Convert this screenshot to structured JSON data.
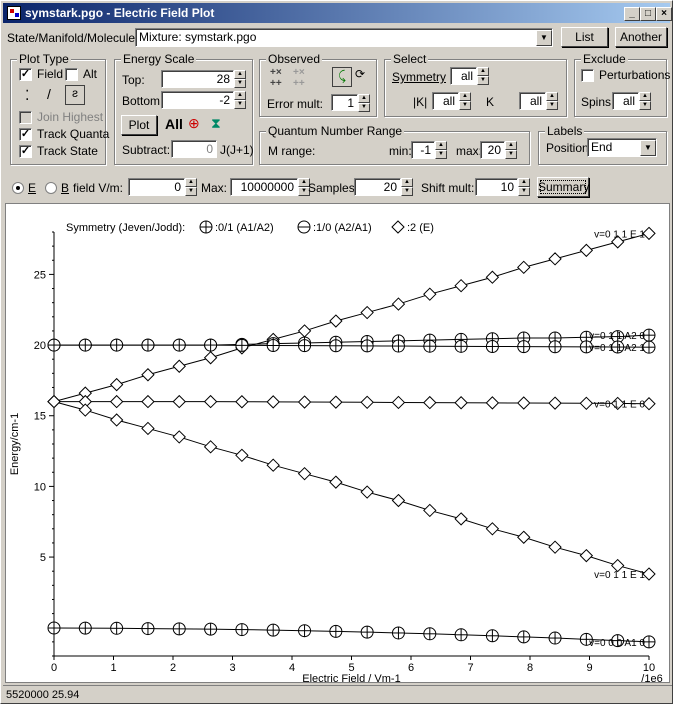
{
  "window": {
    "title": "symstark.pgo - Electric Field Plot"
  },
  "top": {
    "label": "State/Manifold/Molecule:",
    "selected": "Mixture: symstark.pgo",
    "list_button": "List",
    "another_button": "Another"
  },
  "plot_type": {
    "title": "Plot Type",
    "field": "Field",
    "alt": "Alt",
    "join_highest": "Join Highest",
    "track_quanta": "Track Quanta",
    "track_state": "Track State",
    "field_checked": true,
    "alt_checked": false,
    "track_quanta_checked": true,
    "track_state_checked": true
  },
  "energy_scale": {
    "title": "Energy Scale",
    "top_label": "Top:",
    "top_value": "28",
    "bottom_label": "Bottom:",
    "bottom_value": "-2",
    "plot_button": "Plot",
    "all_label": "All",
    "subtract_label": "Subtract:",
    "subtract_value": "0",
    "subtract_unit": "J(J+1)"
  },
  "observed": {
    "title": "Observed",
    "error_mult_label": "Error mult:",
    "error_mult_value": "1"
  },
  "select": {
    "title": "Select",
    "symmetry_label": "Symmetry",
    "symmetry_value": "all",
    "k_abs_label": "|K|",
    "k_abs_value": "all",
    "k_label": "K",
    "k_value": "all"
  },
  "exclude": {
    "title": "Exclude",
    "perturbations": "Perturbations",
    "spins_label": "Spins:",
    "spins_value": "all"
  },
  "qnr": {
    "title": "Quantum Number Range",
    "m_range": "M range:",
    "min_label": "min:",
    "min_value": "-1",
    "max_label": "max:",
    "max_value": "20"
  },
  "labels": {
    "title": "Labels",
    "position_label": "Position",
    "position_value": "End"
  },
  "fieldbar": {
    "e_label": "E",
    "b_label": "B",
    "field_label": "field V/m:",
    "field_value": "0",
    "max_label": "Max:",
    "max_value": "10000000",
    "samples_label": "Samples",
    "samples_value": "20",
    "shift_label": "Shift mult:",
    "shift_value": "10",
    "summary_button": "Summary"
  },
  "status": {
    "text": "5520000  25.94"
  },
  "chart_data": {
    "type": "line",
    "xlabel": "Electric Field / Vm-1",
    "ylabel": "Energy/cm-1",
    "x_multiplier_label": "/1e6",
    "xlim": [
      0,
      10
    ],
    "ylim": [
      -2,
      28
    ],
    "x_ticks": [
      0,
      1,
      2,
      3,
      4,
      5,
      6,
      7,
      8,
      9,
      10
    ],
    "y_ticks": [
      5,
      10,
      15,
      20,
      25
    ],
    "legend": {
      "title": "Symmetry (Jeven/Jodd):",
      "entries": [
        {
          "marker": "circle-plus",
          "label": ":0/1 (A1/A2)"
        },
        {
          "marker": "circle-minus",
          "label": ":1/0 (A2/A1)"
        },
        {
          "marker": "diamond",
          "label": ":2 (E)"
        }
      ]
    },
    "x": [
      0,
      0.526,
      1.053,
      1.579,
      2.105,
      2.632,
      3.158,
      3.684,
      4.211,
      4.737,
      5.263,
      5.789,
      6.316,
      6.842,
      7.368,
      7.895,
      8.421,
      8.947,
      9.474,
      10
    ],
    "series": [
      {
        "marker": "diamond",
        "label": "v=0  1  1 E  1",
        "values": [
          16,
          16.6,
          17.2,
          17.9,
          18.5,
          19.1,
          19.8,
          20.4,
          21.0,
          21.7,
          22.3,
          22.9,
          23.6,
          24.2,
          24.8,
          25.5,
          26.1,
          26.7,
          27.3,
          27.9
        ]
      },
      {
        "marker": "circle-plus",
        "label": "v=0  1  1 A2  0",
        "values": [
          20,
          20.0,
          20.0,
          20.0,
          20.0,
          20.0,
          20.05,
          20.1,
          20.15,
          20.2,
          20.25,
          20.3,
          20.35,
          20.4,
          20.45,
          20.5,
          20.5,
          20.55,
          20.6,
          20.7
        ]
      },
      {
        "marker": "circle-plus",
        "label": "v=0  1  1 A2  1",
        "values": [
          20,
          20.0,
          20.0,
          20.0,
          20.0,
          20.0,
          19.98,
          19.97,
          19.96,
          19.95,
          19.94,
          19.93,
          19.92,
          19.91,
          19.9,
          19.89,
          19.88,
          19.87,
          19.86,
          19.85
        ]
      },
      {
        "marker": "diamond",
        "label": "v=0  1  1 E  0",
        "values": [
          16,
          16.0,
          16.0,
          16.0,
          16.0,
          16.0,
          15.99,
          15.98,
          15.97,
          15.96,
          15.95,
          15.94,
          15.93,
          15.92,
          15.91,
          15.9,
          15.89,
          15.88,
          15.87,
          15.85
        ]
      },
      {
        "marker": "diamond",
        "label": "v=0  1  1 E  1",
        "values": [
          16,
          15.4,
          14.7,
          14.1,
          13.5,
          12.8,
          12.2,
          11.5,
          10.9,
          10.3,
          9.6,
          9.0,
          8.3,
          7.7,
          7.0,
          6.4,
          5.7,
          5.1,
          4.4,
          3.8
        ]
      },
      {
        "marker": "circle-plus",
        "label": "v=0  0  0 A1  0",
        "values": [
          -0.02,
          -0.03,
          -0.04,
          -0.06,
          -0.08,
          -0.1,
          -0.13,
          -0.17,
          -0.21,
          -0.26,
          -0.31,
          -0.37,
          -0.43,
          -0.5,
          -0.57,
          -0.65,
          -0.73,
          -0.82,
          -0.91,
          -1.0
        ]
      }
    ]
  }
}
